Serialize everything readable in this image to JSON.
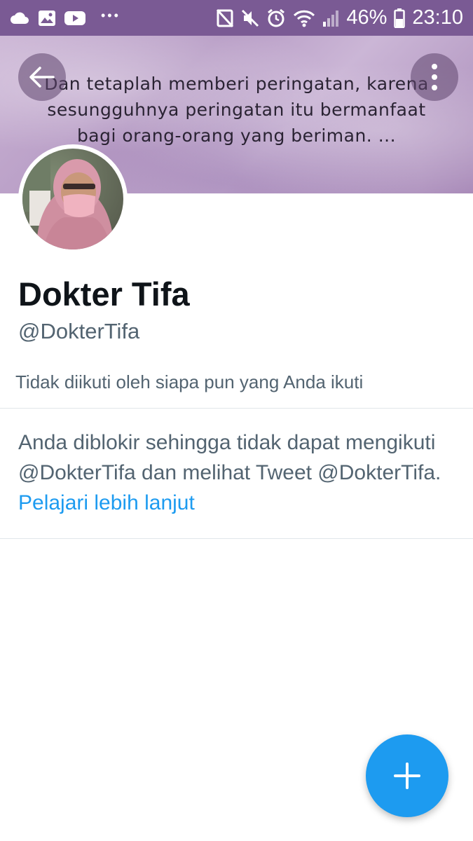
{
  "status_bar": {
    "battery": "46%",
    "time": "23:10",
    "left_icons": [
      "cloud-icon",
      "image-icon",
      "youtube-icon",
      "more-dots-icon"
    ],
    "right_icons": [
      "nfc-off-icon",
      "mute-icon",
      "alarm-icon",
      "wifi-icon",
      "signal-icon",
      "battery-icon"
    ]
  },
  "banner": {
    "quote_lines": [
      "Dan tetaplah memberi peringatan, karena",
      "sesungguhnya peringatan itu bermanfaat",
      "bagi orang-orang yang beriman. ..."
    ]
  },
  "profile": {
    "display_name": "Dokter Tifa",
    "handle": "@DokterTifa",
    "followed_by_text": "Tidak diikuti oleh siapa pun yang Anda ikuti"
  },
  "blocked_notice": {
    "text": "Anda diblokir sehingga tidak dapat mengikuti @DokterTifa dan melihat Tweet @DokterTifa. ",
    "link": "Pelajari lebih lanjut"
  },
  "colors": {
    "status_bar": "#7a5a94",
    "accent": "#1d9bf0",
    "primary_text": "#0f1419",
    "secondary_text": "#536471"
  }
}
